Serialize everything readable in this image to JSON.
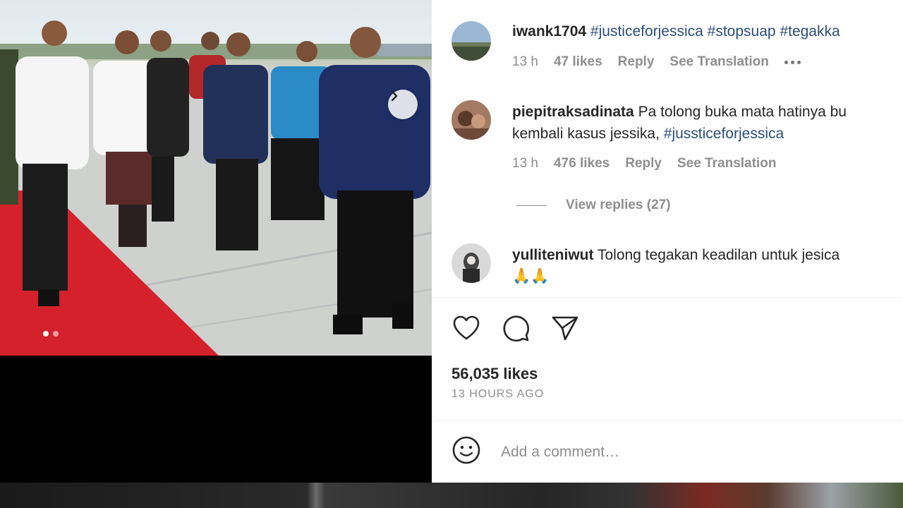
{
  "post": {
    "carousel": {
      "slide_count": 2,
      "active_index": 0
    },
    "likes_label": "56,035 likes",
    "posted_label": "13 HOURS AGO"
  },
  "comments": [
    {
      "username": "iwank1704",
      "text_parts": [
        "#justiceforjessica",
        "#stopsuap",
        "#tegakka"
      ],
      "time": "13 h",
      "likes": "47 likes",
      "reply_label": "Reply",
      "translate_label": "See Translation",
      "more_icon": "ellipsis-icon"
    },
    {
      "username": "piepitraksadinata",
      "line1": "Pa tolong buka mata hatinya bu",
      "line2_text": "kembali kasus jessika,",
      "line2_tag": "#jussticeforjessica",
      "time": "13 h",
      "likes": "476 likes",
      "reply_label": "Reply",
      "translate_label": "See Translation",
      "view_replies": "View replies (27)"
    },
    {
      "username": "yulliteniwut",
      "line1": "Tolong tegakan keadilan untuk jesica",
      "line2": "🙏🙏"
    }
  ],
  "composer": {
    "placeholder": "Add a comment…",
    "emoji_icon": "smiley-icon"
  },
  "icons": {
    "like": "heart-icon",
    "comment": "comment-bubble-icon",
    "share": "paper-plane-icon",
    "carousel_next": "chevron-right-icon"
  },
  "colors": {
    "hashtag": "#2d4d7c",
    "muted": "#8e8e8e",
    "text": "#262626",
    "red_carpet": "#d5212c"
  }
}
